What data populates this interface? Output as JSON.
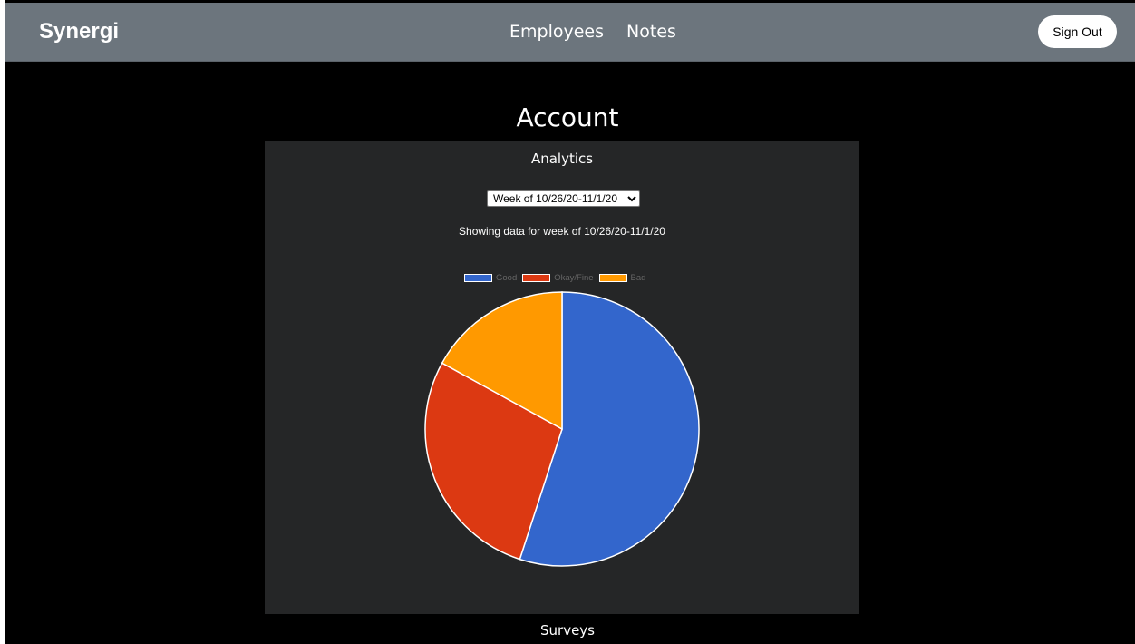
{
  "nav": {
    "brand": "Synergi",
    "links": [
      "Employees",
      "Notes"
    ],
    "signout": "Sign Out"
  },
  "page": {
    "title": "Account",
    "panel_title": "Analytics",
    "selected_week": "Week of 10/26/20-11/1/20",
    "showing_text": "Showing data for week of 10/26/20-11/1/20",
    "footer_title": "Surveys"
  },
  "chart_data": {
    "type": "pie",
    "labels": [
      "Good",
      "Okay/Fine",
      "Bad"
    ],
    "values": [
      55,
      28,
      17
    ],
    "colors": [
      "#3366cc",
      "#dc3912",
      "#ff9900"
    ],
    "legend_position": "top"
  }
}
